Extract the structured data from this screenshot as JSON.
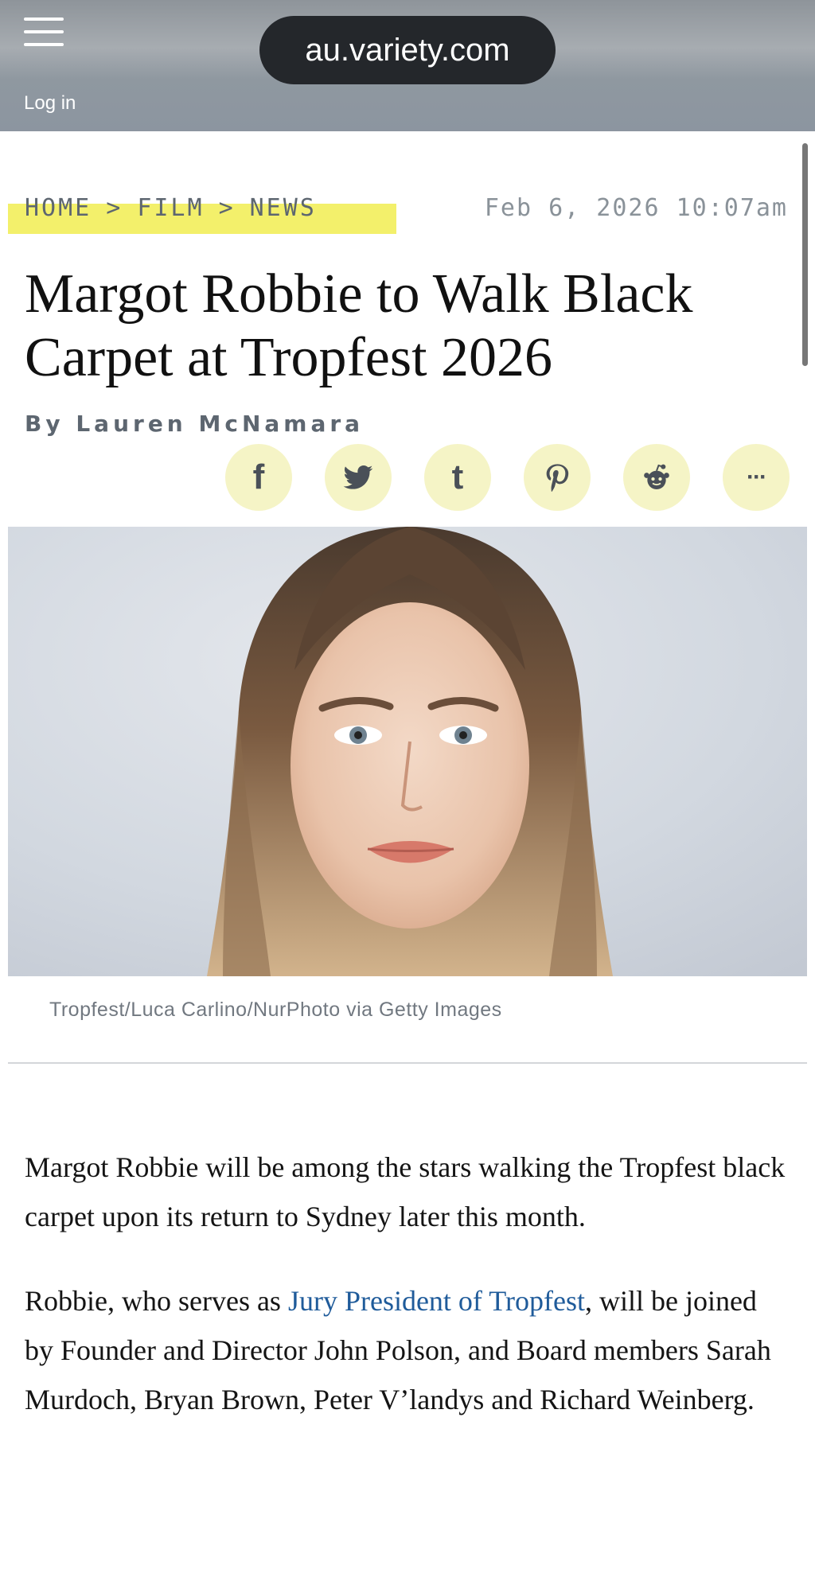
{
  "browser": {
    "url": "au.variety.com",
    "login_label": "Log in"
  },
  "breadcrumb": {
    "items": [
      "HOME",
      "FILM",
      "NEWS"
    ],
    "separator": ">"
  },
  "article": {
    "timestamp": "Feb 6, 2026 10:07am",
    "headline": "Margot Robbie to Walk Black Carpet at Tropfest 2026",
    "byline": "By Lauren McNamara",
    "image_caption": "Tropfest/Luca Carlino/NurPhoto via Getty Images",
    "p1": "Margot Robbie will be among the stars walking the Tropfest black carpet upon its return to Sydney later this month.",
    "p2_before": "Robbie, who serves as ",
    "p2_link": "Jury President of Tropfest",
    "p2_after": ", will be joined by Founder and Director John Polson, and Board members Sarah Murdoch, Bryan Brown, Peter V’landys and Richard Weinberg."
  },
  "share": {
    "icons": [
      "facebook-icon",
      "twitter-icon",
      "tumblr-icon",
      "pinterest-icon",
      "reddit-icon",
      "more-icon"
    ],
    "facebook_glyph": "f",
    "tumblr_glyph": "t",
    "more_glyph": "···"
  },
  "colors": {
    "highlight": "#f3f06b",
    "share_bg": "#f5f4c6",
    "link": "#1f5b9a",
    "meta_gray": "#5d6670"
  }
}
